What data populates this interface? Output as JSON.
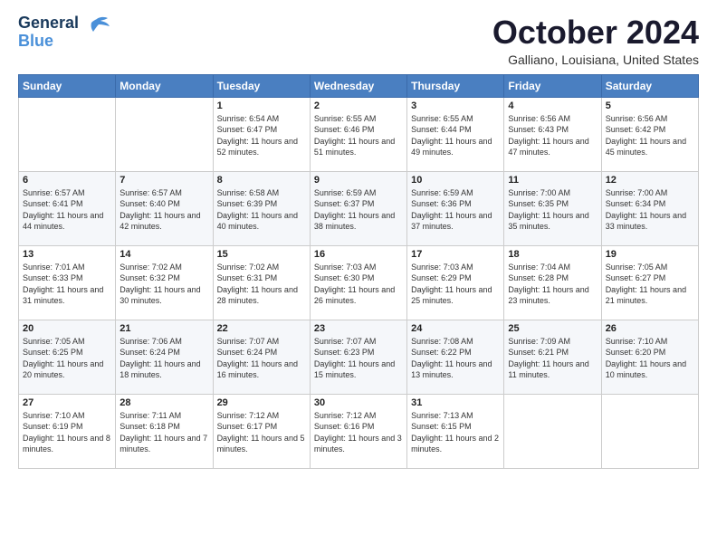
{
  "header": {
    "logo_line1": "General",
    "logo_line2": "Blue",
    "month": "October 2024",
    "location": "Galliano, Louisiana, United States"
  },
  "days_of_week": [
    "Sunday",
    "Monday",
    "Tuesday",
    "Wednesday",
    "Thursday",
    "Friday",
    "Saturday"
  ],
  "weeks": [
    [
      {
        "day": "",
        "sunrise": "",
        "sunset": "",
        "daylight": ""
      },
      {
        "day": "",
        "sunrise": "",
        "sunset": "",
        "daylight": ""
      },
      {
        "day": "1",
        "sunrise": "Sunrise: 6:54 AM",
        "sunset": "Sunset: 6:47 PM",
        "daylight": "Daylight: 11 hours and 52 minutes."
      },
      {
        "day": "2",
        "sunrise": "Sunrise: 6:55 AM",
        "sunset": "Sunset: 6:46 PM",
        "daylight": "Daylight: 11 hours and 51 minutes."
      },
      {
        "day": "3",
        "sunrise": "Sunrise: 6:55 AM",
        "sunset": "Sunset: 6:44 PM",
        "daylight": "Daylight: 11 hours and 49 minutes."
      },
      {
        "day": "4",
        "sunrise": "Sunrise: 6:56 AM",
        "sunset": "Sunset: 6:43 PM",
        "daylight": "Daylight: 11 hours and 47 minutes."
      },
      {
        "day": "5",
        "sunrise": "Sunrise: 6:56 AM",
        "sunset": "Sunset: 6:42 PM",
        "daylight": "Daylight: 11 hours and 45 minutes."
      }
    ],
    [
      {
        "day": "6",
        "sunrise": "Sunrise: 6:57 AM",
        "sunset": "Sunset: 6:41 PM",
        "daylight": "Daylight: 11 hours and 44 minutes."
      },
      {
        "day": "7",
        "sunrise": "Sunrise: 6:57 AM",
        "sunset": "Sunset: 6:40 PM",
        "daylight": "Daylight: 11 hours and 42 minutes."
      },
      {
        "day": "8",
        "sunrise": "Sunrise: 6:58 AM",
        "sunset": "Sunset: 6:39 PM",
        "daylight": "Daylight: 11 hours and 40 minutes."
      },
      {
        "day": "9",
        "sunrise": "Sunrise: 6:59 AM",
        "sunset": "Sunset: 6:37 PM",
        "daylight": "Daylight: 11 hours and 38 minutes."
      },
      {
        "day": "10",
        "sunrise": "Sunrise: 6:59 AM",
        "sunset": "Sunset: 6:36 PM",
        "daylight": "Daylight: 11 hours and 37 minutes."
      },
      {
        "day": "11",
        "sunrise": "Sunrise: 7:00 AM",
        "sunset": "Sunset: 6:35 PM",
        "daylight": "Daylight: 11 hours and 35 minutes."
      },
      {
        "day": "12",
        "sunrise": "Sunrise: 7:00 AM",
        "sunset": "Sunset: 6:34 PM",
        "daylight": "Daylight: 11 hours and 33 minutes."
      }
    ],
    [
      {
        "day": "13",
        "sunrise": "Sunrise: 7:01 AM",
        "sunset": "Sunset: 6:33 PM",
        "daylight": "Daylight: 11 hours and 31 minutes."
      },
      {
        "day": "14",
        "sunrise": "Sunrise: 7:02 AM",
        "sunset": "Sunset: 6:32 PM",
        "daylight": "Daylight: 11 hours and 30 minutes."
      },
      {
        "day": "15",
        "sunrise": "Sunrise: 7:02 AM",
        "sunset": "Sunset: 6:31 PM",
        "daylight": "Daylight: 11 hours and 28 minutes."
      },
      {
        "day": "16",
        "sunrise": "Sunrise: 7:03 AM",
        "sunset": "Sunset: 6:30 PM",
        "daylight": "Daylight: 11 hours and 26 minutes."
      },
      {
        "day": "17",
        "sunrise": "Sunrise: 7:03 AM",
        "sunset": "Sunset: 6:29 PM",
        "daylight": "Daylight: 11 hours and 25 minutes."
      },
      {
        "day": "18",
        "sunrise": "Sunrise: 7:04 AM",
        "sunset": "Sunset: 6:28 PM",
        "daylight": "Daylight: 11 hours and 23 minutes."
      },
      {
        "day": "19",
        "sunrise": "Sunrise: 7:05 AM",
        "sunset": "Sunset: 6:27 PM",
        "daylight": "Daylight: 11 hours and 21 minutes."
      }
    ],
    [
      {
        "day": "20",
        "sunrise": "Sunrise: 7:05 AM",
        "sunset": "Sunset: 6:25 PM",
        "daylight": "Daylight: 11 hours and 20 minutes."
      },
      {
        "day": "21",
        "sunrise": "Sunrise: 7:06 AM",
        "sunset": "Sunset: 6:24 PM",
        "daylight": "Daylight: 11 hours and 18 minutes."
      },
      {
        "day": "22",
        "sunrise": "Sunrise: 7:07 AM",
        "sunset": "Sunset: 6:24 PM",
        "daylight": "Daylight: 11 hours and 16 minutes."
      },
      {
        "day": "23",
        "sunrise": "Sunrise: 7:07 AM",
        "sunset": "Sunset: 6:23 PM",
        "daylight": "Daylight: 11 hours and 15 minutes."
      },
      {
        "day": "24",
        "sunrise": "Sunrise: 7:08 AM",
        "sunset": "Sunset: 6:22 PM",
        "daylight": "Daylight: 11 hours and 13 minutes."
      },
      {
        "day": "25",
        "sunrise": "Sunrise: 7:09 AM",
        "sunset": "Sunset: 6:21 PM",
        "daylight": "Daylight: 11 hours and 11 minutes."
      },
      {
        "day": "26",
        "sunrise": "Sunrise: 7:10 AM",
        "sunset": "Sunset: 6:20 PM",
        "daylight": "Daylight: 11 hours and 10 minutes."
      }
    ],
    [
      {
        "day": "27",
        "sunrise": "Sunrise: 7:10 AM",
        "sunset": "Sunset: 6:19 PM",
        "daylight": "Daylight: 11 hours and 8 minutes."
      },
      {
        "day": "28",
        "sunrise": "Sunrise: 7:11 AM",
        "sunset": "Sunset: 6:18 PM",
        "daylight": "Daylight: 11 hours and 7 minutes."
      },
      {
        "day": "29",
        "sunrise": "Sunrise: 7:12 AM",
        "sunset": "Sunset: 6:17 PM",
        "daylight": "Daylight: 11 hours and 5 minutes."
      },
      {
        "day": "30",
        "sunrise": "Sunrise: 7:12 AM",
        "sunset": "Sunset: 6:16 PM",
        "daylight": "Daylight: 11 hours and 3 minutes."
      },
      {
        "day": "31",
        "sunrise": "Sunrise: 7:13 AM",
        "sunset": "Sunset: 6:15 PM",
        "daylight": "Daylight: 11 hours and 2 minutes."
      },
      {
        "day": "",
        "sunrise": "",
        "sunset": "",
        "daylight": ""
      },
      {
        "day": "",
        "sunrise": "",
        "sunset": "",
        "daylight": ""
      }
    ]
  ]
}
